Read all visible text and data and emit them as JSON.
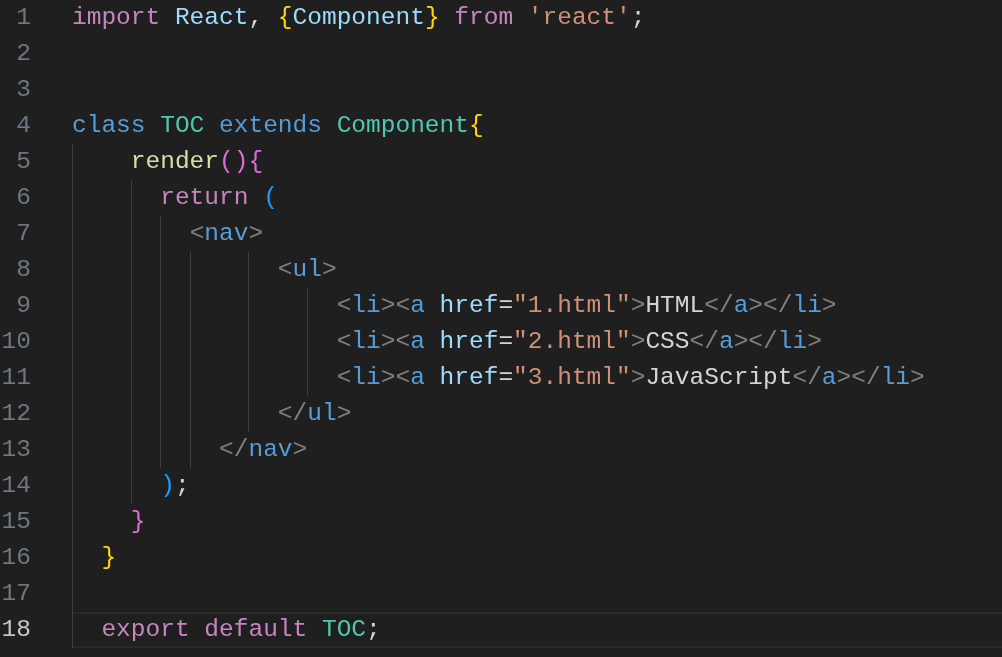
{
  "editor": {
    "lines": [
      {
        "number": "1",
        "current": false,
        "tokens": [
          {
            "text": "import",
            "kind": "keyword"
          },
          {
            "text": " React",
            "kind": "variable"
          },
          {
            "text": ",",
            "kind": "plain"
          },
          {
            "text": " {",
            "kind": "bracket1"
          },
          {
            "text": "Component",
            "kind": "variable"
          },
          {
            "text": "}",
            "kind": "bracket1"
          },
          {
            "text": " from",
            "kind": "keyword"
          },
          {
            "text": " 'react'",
            "kind": "string"
          },
          {
            "text": ";",
            "kind": "plain"
          }
        ]
      },
      {
        "number": "2",
        "current": false
      },
      {
        "number": "3",
        "current": false
      },
      {
        "number": "4",
        "current": false,
        "tokens": [
          {
            "text": "class",
            "kind": "storage"
          },
          {
            "text": " TOC",
            "kind": "class"
          },
          {
            "text": " extends",
            "kind": "storage"
          },
          {
            "text": " Component",
            "kind": "class"
          },
          {
            "text": "{",
            "kind": "bracket1"
          }
        ]
      },
      {
        "number": "5",
        "current": false,
        "tokens": [
          {
            "text": "    render",
            "kind": "function"
          },
          {
            "text": "(){",
            "kind": "bracket2"
          }
        ]
      },
      {
        "number": "6",
        "current": false,
        "tokens": [
          {
            "text": "      return",
            "kind": "keyword"
          },
          {
            "text": " (",
            "kind": "bracket3"
          }
        ]
      },
      {
        "number": "7",
        "current": false,
        "tokens": [
          {
            "text": "        <",
            "kind": "punct"
          },
          {
            "text": "nav",
            "kind": "tag"
          },
          {
            "text": ">",
            "kind": "punct"
          }
        ]
      },
      {
        "number": "8",
        "current": false,
        "tokens": [
          {
            "text": "              <",
            "kind": "punct"
          },
          {
            "text": "ul",
            "kind": "tag"
          },
          {
            "text": ">",
            "kind": "punct"
          }
        ]
      },
      {
        "number": "9",
        "current": false,
        "tokens": [
          {
            "text": "                  <",
            "kind": "punct"
          },
          {
            "text": "li",
            "kind": "tag"
          },
          {
            "text": "><",
            "kind": "punct"
          },
          {
            "text": "a",
            "kind": "tag"
          },
          {
            "text": " href",
            "kind": "variable"
          },
          {
            "text": "=",
            "kind": "plain"
          },
          {
            "text": "\"1.html\"",
            "kind": "string"
          },
          {
            "text": ">",
            "kind": "punct"
          },
          {
            "text": "HTML",
            "kind": "plain"
          },
          {
            "text": "</",
            "kind": "punct"
          },
          {
            "text": "a",
            "kind": "tag"
          },
          {
            "text": "></",
            "kind": "punct"
          },
          {
            "text": "li",
            "kind": "tag"
          },
          {
            "text": ">",
            "kind": "punct"
          }
        ]
      },
      {
        "number": "10",
        "current": false,
        "tokens": [
          {
            "text": "                  <",
            "kind": "punct"
          },
          {
            "text": "li",
            "kind": "tag"
          },
          {
            "text": "><",
            "kind": "punct"
          },
          {
            "text": "a",
            "kind": "tag"
          },
          {
            "text": " href",
            "kind": "variable"
          },
          {
            "text": "=",
            "kind": "plain"
          },
          {
            "text": "\"2.html\"",
            "kind": "string"
          },
          {
            "text": ">",
            "kind": "punct"
          },
          {
            "text": "CSS",
            "kind": "plain"
          },
          {
            "text": "</",
            "kind": "punct"
          },
          {
            "text": "a",
            "kind": "tag"
          },
          {
            "text": "></",
            "kind": "punct"
          },
          {
            "text": "li",
            "kind": "tag"
          },
          {
            "text": ">",
            "kind": "punct"
          }
        ]
      },
      {
        "number": "11",
        "current": false,
        "tokens": [
          {
            "text": "                  <",
            "kind": "punct"
          },
          {
            "text": "li",
            "kind": "tag"
          },
          {
            "text": "><",
            "kind": "punct"
          },
          {
            "text": "a",
            "kind": "tag"
          },
          {
            "text": " href",
            "kind": "variable"
          },
          {
            "text": "=",
            "kind": "plain"
          },
          {
            "text": "\"3.html\"",
            "kind": "string"
          },
          {
            "text": ">",
            "kind": "punct"
          },
          {
            "text": "JavaScript",
            "kind": "plain"
          },
          {
            "text": "</",
            "kind": "punct"
          },
          {
            "text": "a",
            "kind": "tag"
          },
          {
            "text": "></",
            "kind": "punct"
          },
          {
            "text": "li",
            "kind": "tag"
          },
          {
            "text": ">",
            "kind": "punct"
          }
        ]
      },
      {
        "number": "12",
        "current": false,
        "tokens": [
          {
            "text": "              </",
            "kind": "punct"
          },
          {
            "text": "ul",
            "kind": "tag"
          },
          {
            "text": ">",
            "kind": "punct"
          }
        ]
      },
      {
        "number": "13",
        "current": false,
        "tokens": [
          {
            "text": "          </",
            "kind": "punct"
          },
          {
            "text": "nav",
            "kind": "tag"
          },
          {
            "text": ">",
            "kind": "punct"
          }
        ]
      },
      {
        "number": "14",
        "current": false,
        "tokens": [
          {
            "text": "      )",
            "kind": "bracket3"
          },
          {
            "text": ";",
            "kind": "plain"
          }
        ]
      },
      {
        "number": "15",
        "current": false,
        "tokens": [
          {
            "text": "    }",
            "kind": "bracket2"
          }
        ]
      },
      {
        "number": "16",
        "current": false,
        "tokens": [
          {
            "text": "  }",
            "kind": "bracket1"
          }
        ]
      },
      {
        "number": "17",
        "current": false
      },
      {
        "number": "18",
        "current": true,
        "tokens": [
          {
            "text": "  export",
            "kind": "keyword"
          },
          {
            "text": " default",
            "kind": "keyword"
          },
          {
            "text": " TOC",
            "kind": "class"
          },
          {
            "text": ";",
            "kind": "plain"
          }
        ]
      }
    ]
  }
}
